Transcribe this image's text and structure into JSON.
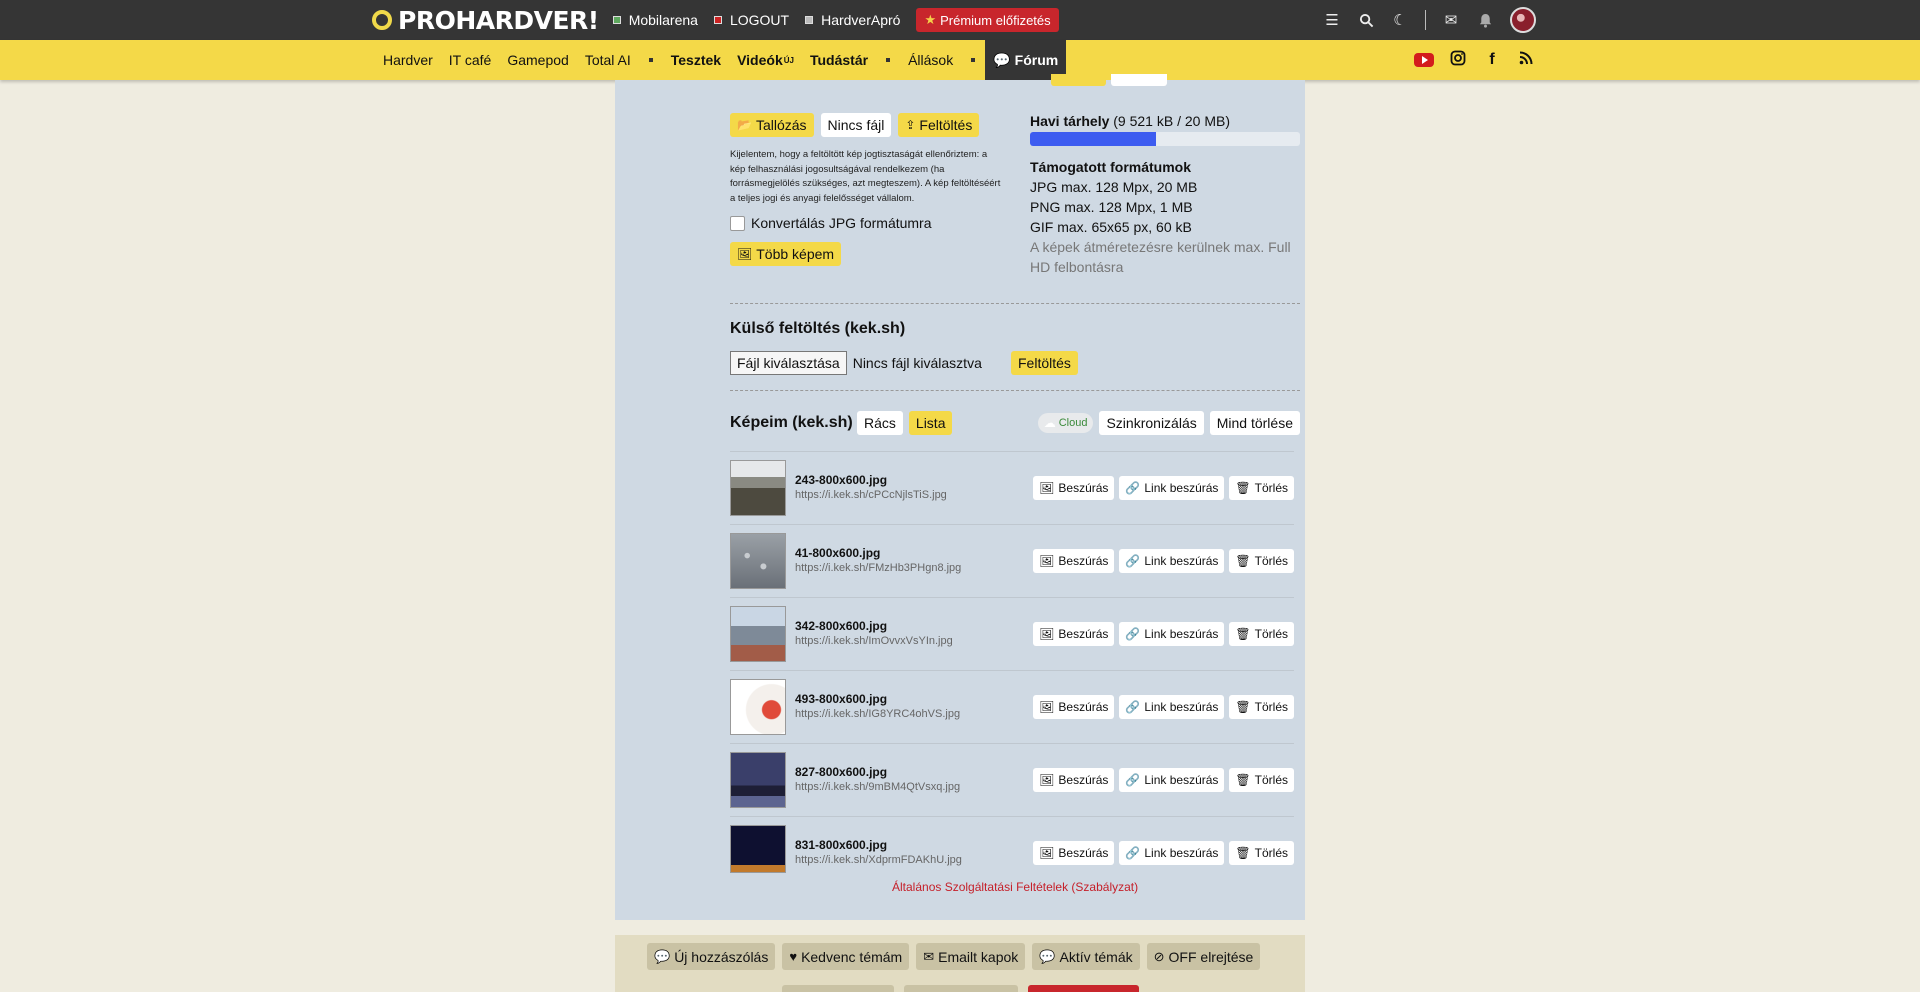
{
  "topbar": {
    "logo": "PROHARDVER!",
    "links": [
      {
        "label": "Mobilarena",
        "color": "green"
      },
      {
        "label": "LOGOUT",
        "color": "red"
      },
      {
        "label": "HardverApró",
        "color": "grey"
      }
    ],
    "premium": "Prémium előfizetés",
    "icons": [
      "sliders-icon",
      "search-icon",
      "moon-icon",
      "mail-icon",
      "bell-icon"
    ]
  },
  "nav": {
    "items": [
      "Hardver",
      "IT café",
      "Gamepod",
      "Total AI"
    ],
    "bold_items": [
      "Tesztek",
      "Videók",
      "Tudástár"
    ],
    "videos_badge": "ÚJ",
    "jobs": "Állások",
    "forum": "Fórum"
  },
  "upload": {
    "browse": "Tallózás",
    "no_file": "Nincs fájl",
    "upload": "Feltöltés",
    "disclaimer": "Kijelentem, hogy a feltöltött kép jogtisztaságát ellenőriztem: a kép felhasználási jogosultságával rendelkezem (ha forrásmegjelölés szükséges, azt megteszem). A kép feltöltéséért a teljes jogi és anyagi felelősséget vállalom.",
    "convert_label": "Konvertálás JPG formátumra",
    "more_images": "Több képem"
  },
  "quota": {
    "title": "Havi tárhely",
    "value": "(9 521 kB / 20 MB)",
    "fraction": 0.465
  },
  "formats": {
    "title": "Támogatott formátumok",
    "lines": [
      "JPG max. 128 Mpx, 20 MB",
      "PNG max. 128 Mpx, 1 MB",
      "GIF max. 65x65 px, 60 kB"
    ],
    "note": "A képek átméretezésre kerülnek max. Full HD felbontásra"
  },
  "external": {
    "title": "Külső feltöltés (kek.sh)",
    "choose": "Fájl kiválasztása",
    "status": "Nincs fájl kiválasztva",
    "upload": "Feltöltés"
  },
  "gallery": {
    "title": "Képeim (kek.sh)",
    "grid": "Rács",
    "list": "Lista",
    "cloud": "Cloud",
    "sync": "Szinkronizálás",
    "delete_all": "Mind törlése",
    "insert": "Beszúrás",
    "insert_link": "Link beszúrás",
    "delete": "Törlés",
    "images": [
      {
        "name": "243-800x600.jpg",
        "url": "https://i.kek.sh/cPCcNjlsTiS.jpg"
      },
      {
        "name": "41-800x600.jpg",
        "url": "https://i.kek.sh/FMzHb3PHgn8.jpg"
      },
      {
        "name": "342-800x600.jpg",
        "url": "https://i.kek.sh/ImOvvxVsYIn.jpg"
      },
      {
        "name": "493-800x600.jpg",
        "url": "https://i.kek.sh/IG8YRC4ohVS.jpg"
      },
      {
        "name": "827-800x600.jpg",
        "url": "https://i.kek.sh/9mBM4QtVsxq.jpg"
      },
      {
        "name": "831-800x600.jpg",
        "url": "https://i.kek.sh/XdprmFDAKhU.jpg"
      }
    ]
  },
  "tos": "Általános Szolgáltatási Feltételek (Szabályzat)",
  "bottom": {
    "new_post": "Új hozzászólás",
    "favorite": "Kedvenc témám",
    "email": "Emailt kapok",
    "active": "Aktív témák",
    "off": "OFF elrejtése"
  },
  "colors": {
    "accent": "#f4d948",
    "dark": "#353535",
    "danger": "#c8262c",
    "progress": "#3d5cf0",
    "panel": "#cfd9e3"
  }
}
